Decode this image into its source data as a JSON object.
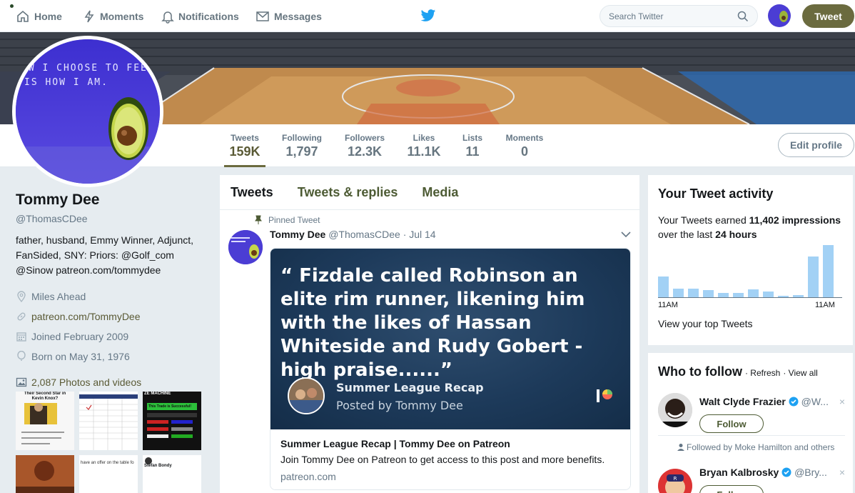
{
  "nav": {
    "home": "Home",
    "moments": "Moments",
    "notifications": "Notifications",
    "messages": "Messages",
    "search_placeholder": "Search Twitter",
    "tweet_button": "Tweet"
  },
  "avatar_caption": [
    "OW I CHOOSE TO FEEL...",
    "IS HOW I AM."
  ],
  "stats": [
    {
      "label": "Tweets",
      "value": "159K"
    },
    {
      "label": "Following",
      "value": "1,797"
    },
    {
      "label": "Followers",
      "value": "12.3K"
    },
    {
      "label": "Likes",
      "value": "11.1K"
    },
    {
      "label": "Lists",
      "value": "11"
    },
    {
      "label": "Moments",
      "value": "0"
    }
  ],
  "edit_profile": "Edit profile",
  "profile": {
    "name": "Tommy Dee",
    "handle": "@ThomasCDee",
    "bio_lines": [
      "father, husband, Emmy Winner, Adjunct,",
      "FanSided, SNY: Priors: @Golf_com",
      "@Sinow patreon.com/tommydee"
    ],
    "location": "Miles Ahead",
    "website": "patreon.com/TommyDee",
    "joined": "Joined February 2009",
    "born": "Born on May 31, 1976",
    "photos": "2,087 Photos and videos"
  },
  "thumbs": {
    "t1": "Their Second Star in Kevin Knox?",
    "t2": "This Trade is Successful!",
    "t3": "ZE MACHINE",
    "t4": "have an offer on the table fo",
    "t5": "Stefan Bondy"
  },
  "tabs": [
    "Tweets",
    "Tweets & replies",
    "Media"
  ],
  "tweet": {
    "pinned": "Pinned Tweet",
    "author": "Tommy Dee",
    "handle": "@ThomasCDee",
    "date": "· Jul 14",
    "quote": "“ Fizdale called Robinson an elite rim runner, likening him with the likes of Hassan Whiteside and Rudy Gobert - high praise......”",
    "recap_title": "Summer League Recap",
    "recap_sub": "Posted by Tommy Dee",
    "card_title": "Summer League Recap | Tommy Dee on Patreon",
    "card_desc": "Join Tommy Dee on Patreon to get access to this post and more benefits.",
    "card_url": "patreon.com"
  },
  "activity": {
    "title": "Your Tweet activity",
    "text_prefix": "Your Tweets earned ",
    "impressions": "11,402 impressions",
    "text_mid": "over the last ",
    "period": "24 hours",
    "tick_left": "11AM",
    "tick_right": "11AM",
    "link": "View your top Tweets",
    "bar_levels": [
      0.39,
      0.16,
      0.16,
      0.14,
      0.08,
      0.08,
      0.15,
      0.11,
      0.03,
      0.04,
      0.77,
      0.98
    ]
  },
  "who_to_follow": {
    "title": "Who to follow",
    "refresh": "· Refresh",
    "view_all": "· View all",
    "follow": "Follow",
    "users": [
      {
        "name": "Walt Clyde Frazier",
        "handle": "@W..."
      },
      {
        "name": "Bryan Kalbrosky",
        "handle": "@Bry..."
      }
    ],
    "followed_by": "Followed by Moke Hamilton and others"
  },
  "colors": {
    "accent": "#6b6b3f",
    "twitter_blue": "#1da1f2",
    "chart_bar": "#a2d1f5"
  }
}
